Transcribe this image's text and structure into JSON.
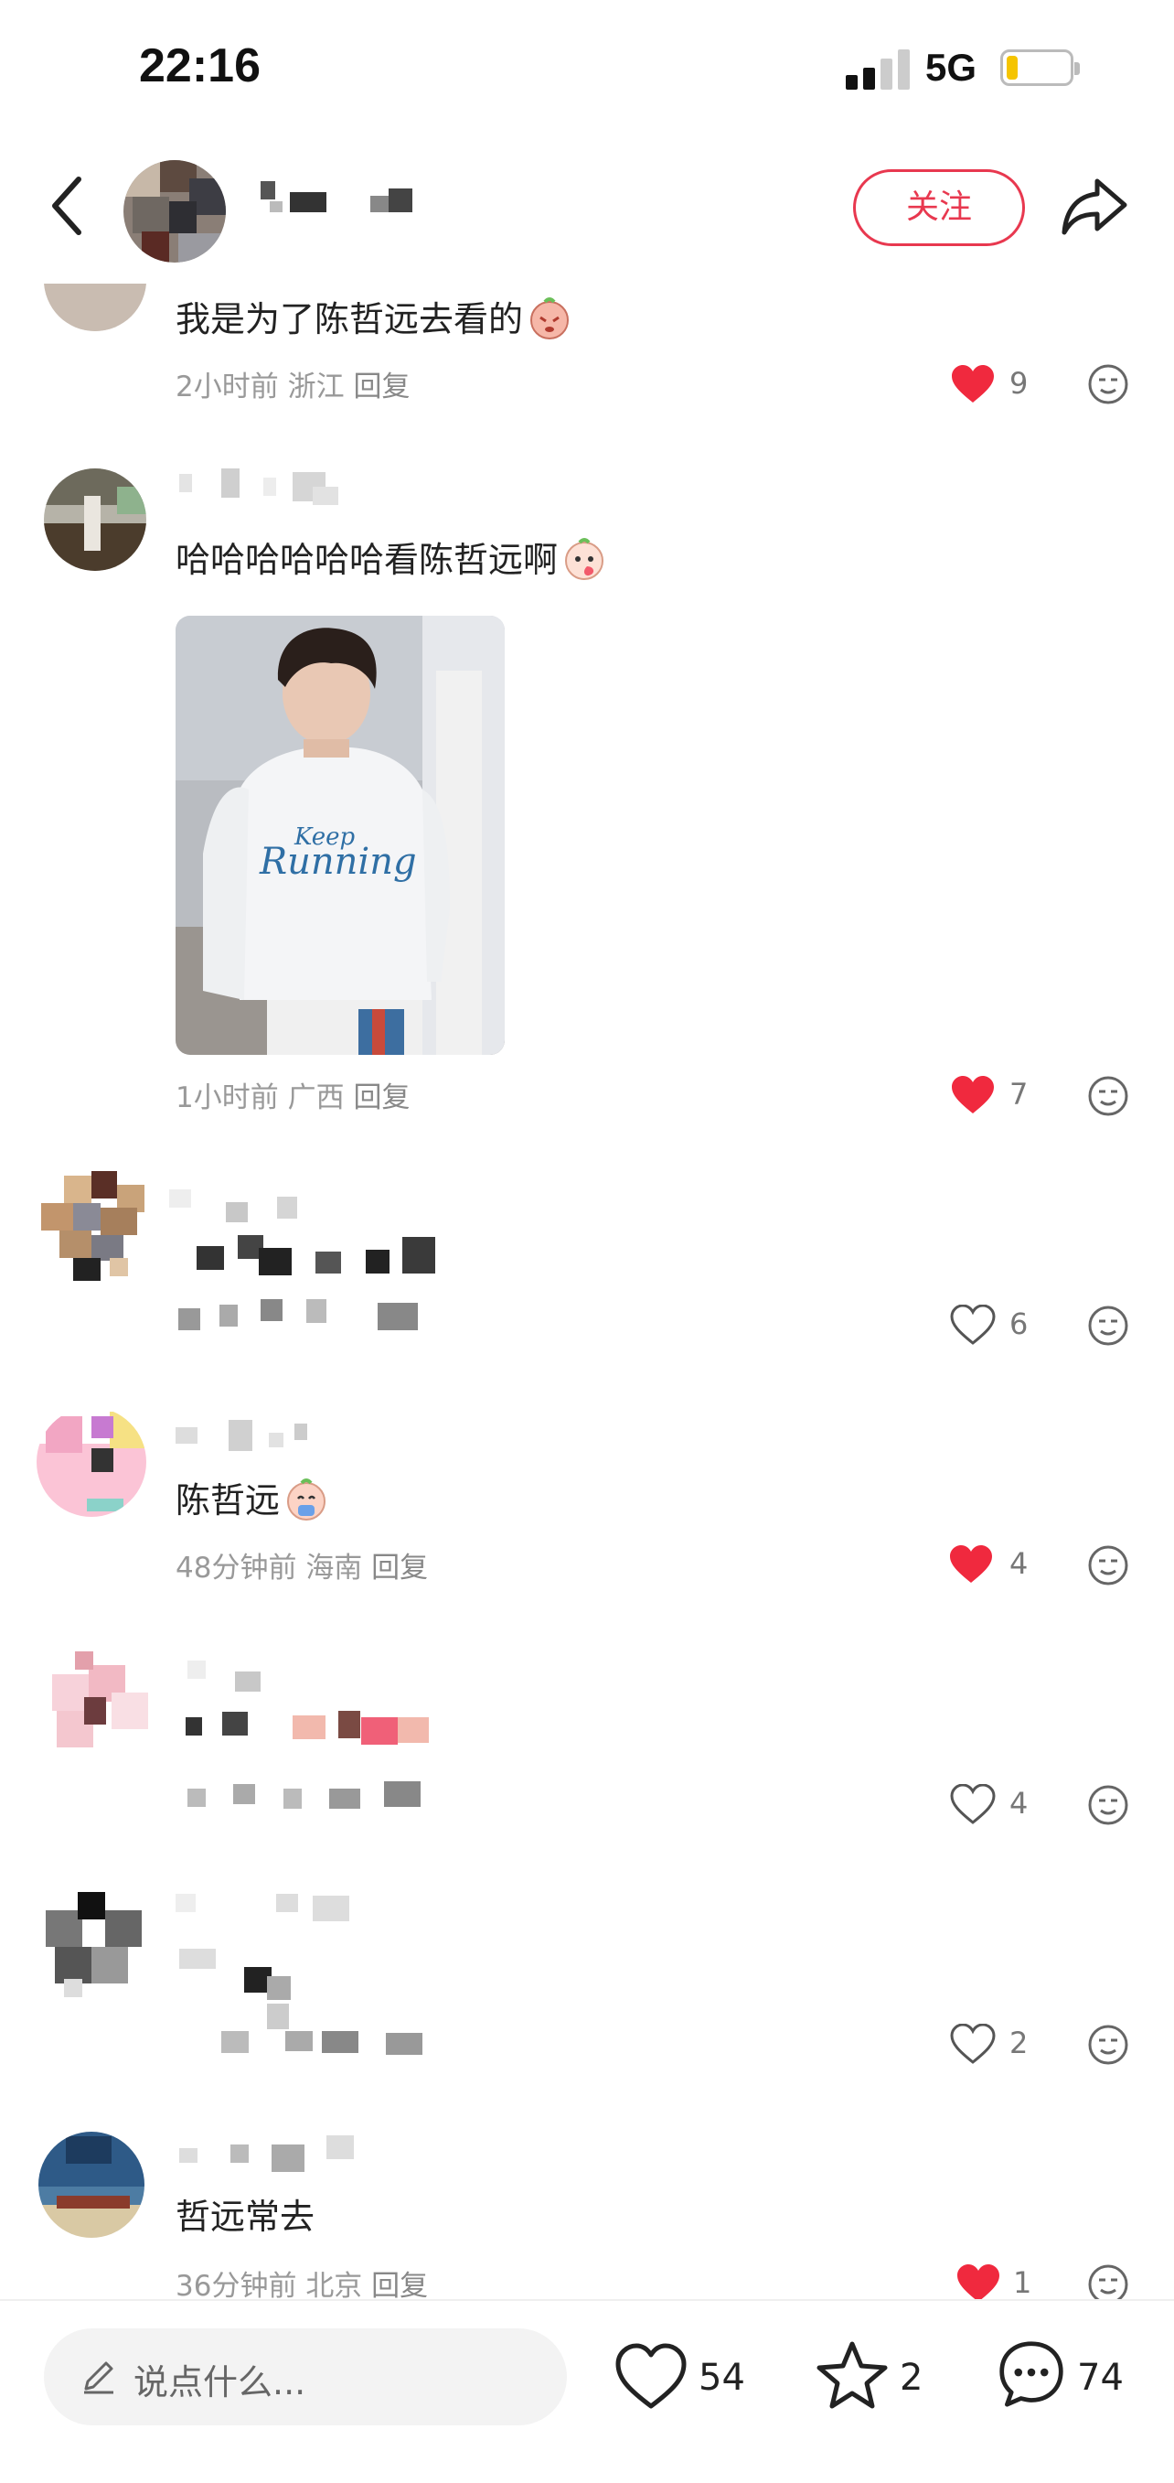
{
  "status_bar": {
    "time": "22:16",
    "network": "5G"
  },
  "header": {
    "follow_label": "关注"
  },
  "comments": [
    {
      "text": "我是为了陈哲远去看的",
      "emoji": "sticker",
      "time": "2小时前",
      "location": "浙江",
      "reply": "回复",
      "likes": "9",
      "liked": true
    },
    {
      "text": "哈哈哈哈哈哈看陈哲远啊",
      "emoji": "sticker",
      "time": "1小时前",
      "location": "广西",
      "reply": "回复",
      "likes": "7",
      "liked": true
    },
    {
      "likes": "6",
      "liked": false
    },
    {
      "text": "陈哲远",
      "emoji": "sticker",
      "time": "48分钟前",
      "location": "海南",
      "reply": "回复",
      "likes": "4",
      "liked": true
    },
    {
      "likes": "4",
      "liked": false
    },
    {
      "likes": "2",
      "liked": false
    },
    {
      "text": "哲远常去",
      "time": "36分钟前",
      "location": "北京",
      "reply": "回复",
      "likes": "1",
      "liked": true
    }
  ],
  "photo": {
    "shirt_text_1": "Keep",
    "shirt_text_2": "Running"
  },
  "bottom_bar": {
    "input_placeholder": "说点什么...",
    "likes": "54",
    "favorites": "2",
    "comments": "74"
  },
  "colors": {
    "accent": "#e8384f",
    "liked": "#f0293e",
    "icon": "#666666"
  },
  "icons": [
    "back-arrow-icon",
    "share-icon",
    "heart-icon",
    "emoji-face-icon",
    "pencil-icon",
    "star-icon",
    "chat-bubble-icon"
  ]
}
